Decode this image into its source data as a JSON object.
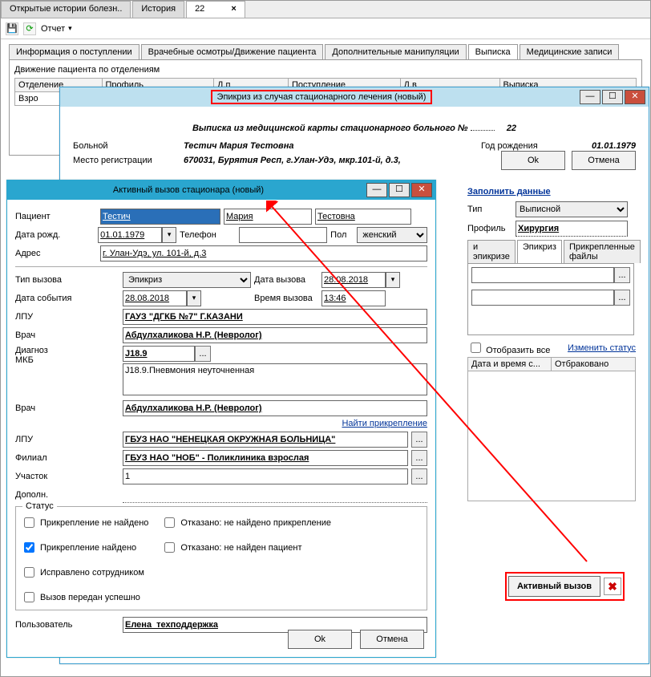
{
  "tabs_outer": {
    "t1": "Открытые истории болезн..",
    "t2": "История",
    "t3": "22",
    "close": "×"
  },
  "toolbar": {
    "save_icon": "💾",
    "refresh_icon": "⟳",
    "report": "Отчет",
    "caret": "▾"
  },
  "subtabs": {
    "t1": "Информация о поступлении",
    "t2": "Врачебные осмотры/Движение пациента",
    "t3": "Дополнительные манипуляции",
    "t4": "Выписка",
    "t5": "Медицинские записи"
  },
  "movement": {
    "title": "Движение пациента по отделениям",
    "cols": {
      "c1": "Отделение",
      "c2": "Профиль",
      "c3": "Д.п",
      "c4": "Поступление",
      "c5": "Д.в",
      "c6": "Выписка"
    },
    "row": {
      "c1": "Взро"
    }
  },
  "epicrisis": {
    "title": "Эпикриз из случая стационарного лечения (новый)",
    "win_min": "—",
    "win_max": "☐",
    "win_close": "✕",
    "excerpt_left": "Выписка из медицинской карты стационарного больного №",
    "excerpt_no": "22",
    "patient_lab": "Больной",
    "patient_val": "Тестич Мария Тестовна",
    "birth_lab": "Год рождения",
    "birth_val": "01.01.1979",
    "reg_lab": "Место регистрации",
    "reg_val": "670031, Бурятия Респ, г.Улан-Удэ, мкр.101-й, д.3,",
    "fill_link": "Заполнить данные",
    "type_lab": "Тип",
    "type_val": "Выписной",
    "profile_lab": "Профиль",
    "profile_val": "Хирургия",
    "itab1": "и эпикризе",
    "itab2": "Эпикриз",
    "itab3": "Прикрепленные файлы",
    "show_all": "Отобразить все",
    "change_status": "Изменить статус",
    "gcol1": "Дата и время с...",
    "gcol2": "Отбраковано",
    "activecall_btn": "Активный вызов",
    "x": "✖",
    "ok": "Ok",
    "cancel": "Отмена"
  },
  "call": {
    "title": "Активный вызов стационара (новый)",
    "win_min": "—",
    "win_max": "☐",
    "win_close": "✕",
    "lab_patient": "Пациент",
    "p_surname": "Тестич",
    "p_first": "Мария",
    "p_patr": "Тестовна",
    "lab_birth": "Дата рожд.",
    "birth": "01.01.1979",
    "lab_phone": "Телефон",
    "phone": "",
    "lab_sex": "Пол",
    "sex": "женский",
    "lab_addr": "Адрес",
    "addr": "г. Улан-Удэ, ул. 101-й, д.3",
    "lab_calltype": "Тип вызова",
    "calltype": "Эпикриз",
    "lab_calldate": "Дата вызова",
    "calldate": "28.08.2018",
    "lab_eventdate": "Дата события",
    "eventdate": "28.08.2018",
    "lab_calltime": "Время вызова",
    "calltime": "13:46",
    "lab_lpu": "ЛПУ",
    "lpu": "ГАУЗ \"ДГКБ №7\" Г.КАЗАНИ",
    "lab_doctor": "Врач",
    "doctor": "Абдулхаликова Н.Р. (Невролог)",
    "lab_diag": "Диагноз",
    "lab_mkb": "МКБ",
    "mkb": "J18.9",
    "mkb_text": "J18.9.Пневмония неуточненная",
    "lab_doctor2": "Врач",
    "doctor2": "Абдулхаликова Н.Р. (Невролог)",
    "find_attach": "Найти прикрепление",
    "lab_lpu2": "ЛПУ",
    "lpu2": "ГБУЗ НАО \"НЕНЕЦКАЯ ОКРУЖНАЯ БОЛЬНИЦА\"",
    "lab_branch": "Филиал",
    "branch": "ГБУЗ НАО \"НОБ\" - Поликлиника взрослая",
    "lab_area": "Участок",
    "area": "1",
    "lab_extra": "Дополн.",
    "status_title": "Статус",
    "st1": "Прикрепление не найдено",
    "st2": "Прикрепление найдено",
    "st3": "Исправлено сотрудником",
    "st4": "Вызов передан успешно",
    "st5": "Отказано: не найдено прикрепление",
    "st6": "Отказано: не найден пациент",
    "lab_user": "Пользователь",
    "user": "Елена  техподдержка",
    "ok": "Ok",
    "cancel": "Отмена",
    "dots": "...",
    "dp": "▾"
  }
}
